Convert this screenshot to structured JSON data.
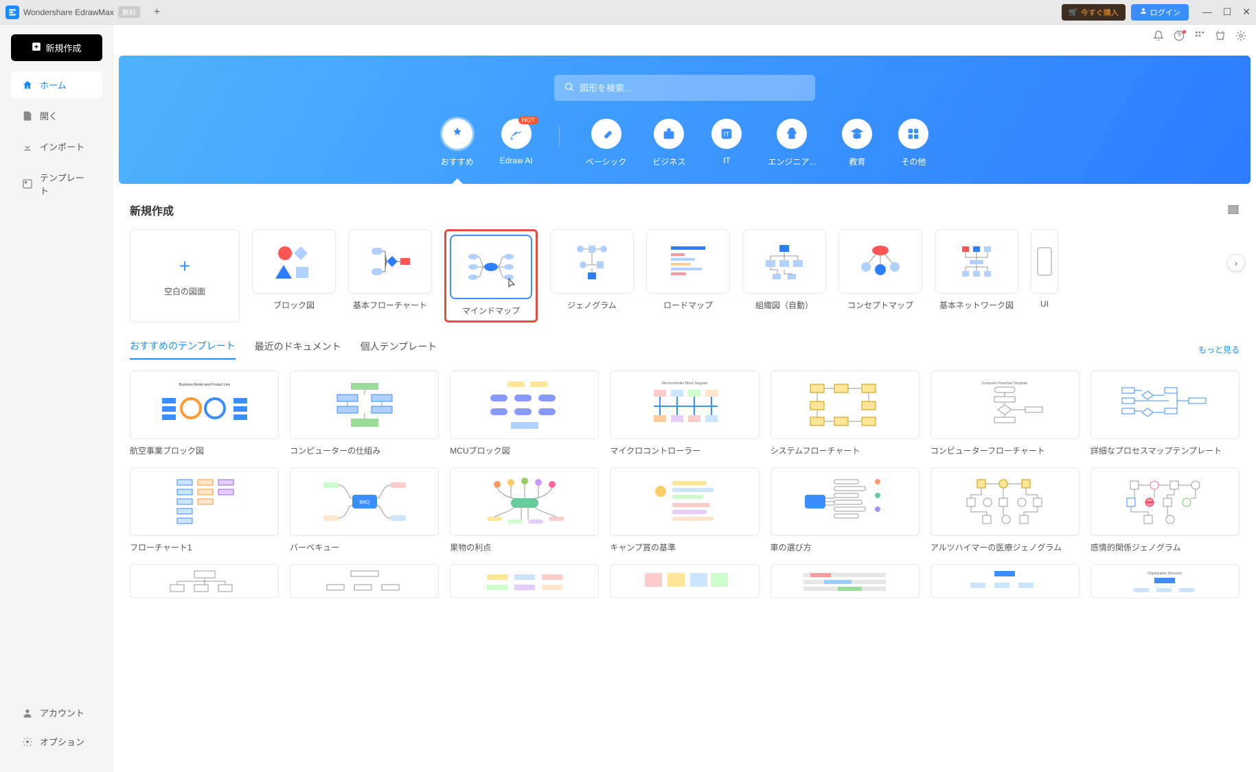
{
  "titlebar": {
    "app_name": "Wondershare EdrawMax",
    "free_badge": "無料",
    "buy_now": "今すぐ購入",
    "login": "ログイン"
  },
  "sidebar": {
    "new_document": "新規作成",
    "items": [
      {
        "label": "ホーム",
        "icon": "home"
      },
      {
        "label": "開く",
        "icon": "file"
      },
      {
        "label": "インポート",
        "icon": "import"
      },
      {
        "label": "テンプレート",
        "icon": "template"
      }
    ],
    "bottom": [
      {
        "label": "アカウント",
        "icon": "account"
      },
      {
        "label": "オプション",
        "icon": "settings"
      }
    ]
  },
  "hero": {
    "search_placeholder": "図形を検索...",
    "categories": [
      {
        "label": "おすすめ",
        "icon": "star",
        "active": true
      },
      {
        "label": "Edraw AI",
        "icon": "ai",
        "hot": true
      },
      {
        "label": "ベーシック",
        "icon": "tag"
      },
      {
        "label": "ビジネス",
        "icon": "briefcase"
      },
      {
        "label": "IT",
        "icon": "it"
      },
      {
        "label": "エンジニア...",
        "icon": "engineer"
      },
      {
        "label": "教育",
        "icon": "edu"
      },
      {
        "label": "その他",
        "icon": "more"
      }
    ]
  },
  "new_section": {
    "title": "新規作成",
    "blank": "空白の図面",
    "templates": [
      {
        "label": "ブロック図"
      },
      {
        "label": "基本フローチャート"
      },
      {
        "label": "マインドマップ",
        "highlighted": true
      },
      {
        "label": "ジェノグラム"
      },
      {
        "label": "ロードマップ"
      },
      {
        "label": "組織図（自動）"
      },
      {
        "label": "コンセプトマップ"
      },
      {
        "label": "基本ネットワーク図"
      },
      {
        "label": "UI"
      }
    ]
  },
  "tabs": {
    "items": [
      "おすすめのテンプレート",
      "最近のドキュメント",
      "個人テンプレート"
    ],
    "more": "もっと見る"
  },
  "template_grid": {
    "row1": [
      "航空事業ブロック図",
      "コンピューターの仕組み",
      "MCUブロック図",
      "マイクロコントローラー",
      "システムフローチャート",
      "コンピューターフローチャート",
      "詳細なプロセスマップテンプレート"
    ],
    "row2": [
      "フローチャート1",
      "バーベキュー",
      "果物の利点",
      "キャンプ賞の基準",
      "車の選び方",
      "アルツハイマーの医療ジェノグラム",
      "感情的関係ジェノグラム"
    ]
  }
}
